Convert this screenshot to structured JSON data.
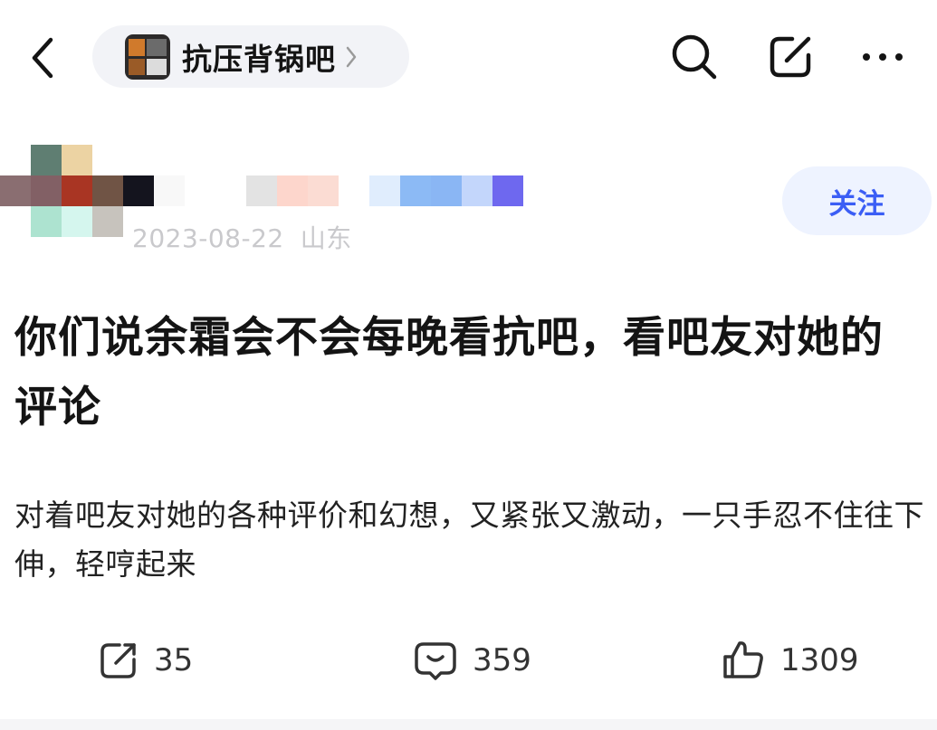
{
  "topbar": {
    "back_icon": "chevron-left-icon",
    "forum_name": "抗压背锅吧",
    "forum_chevron_icon": "chevron-right-icon",
    "search_icon": "search-icon",
    "edit_icon": "compose-icon",
    "more_icon": "more-horizontal-icon"
  },
  "author": {
    "date": "2023-08-22",
    "location": "山东",
    "follow_label": "关注"
  },
  "post": {
    "title": "你们说余霜会不会每晚看抗吧，看吧友对她的评论",
    "body": "对着吧友对她的各种评价和幻想，又紧张又激动，一只手忍不住往下伸，轻哼起来"
  },
  "stats": {
    "share_icon": "share-icon",
    "share_count": "35",
    "comment_icon": "comment-icon",
    "comment_count": "359",
    "like_icon": "thumbs-up-icon",
    "like_count": "1309"
  },
  "colors": {
    "accent": "#3b5ef5",
    "follow_bg": "#eef3ff",
    "pill_bg": "#f2f3f7",
    "meta_text": "#c9c9cc"
  }
}
